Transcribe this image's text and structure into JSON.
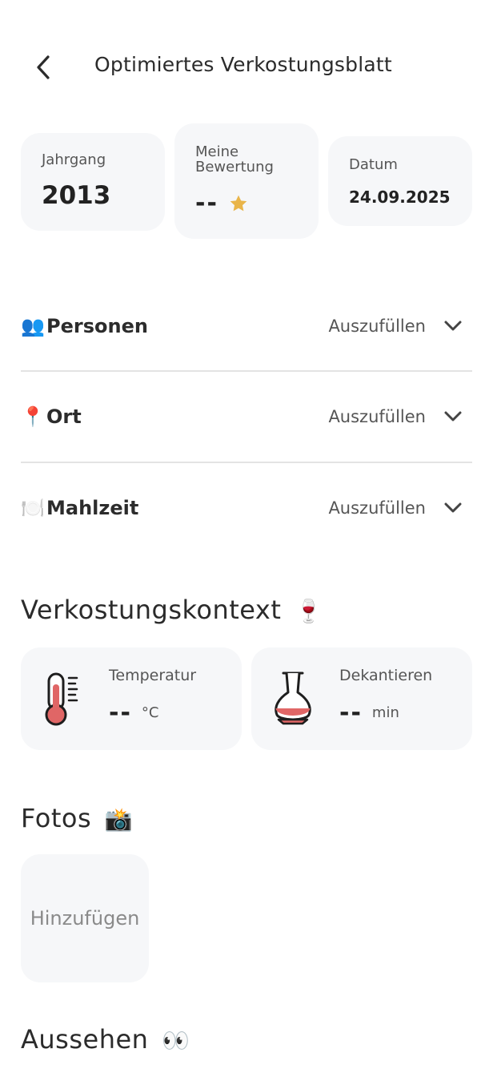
{
  "header": {
    "title": "Optimiertes Verkostungsblatt",
    "back_icon": "chevron-left-icon"
  },
  "cards": {
    "vintage": {
      "label": "Jahrgang",
      "value": "2013"
    },
    "rating": {
      "label_line1": "Meine",
      "label_line2": "Bewertung",
      "value": "--",
      "star_color": "#e9b54a"
    },
    "date": {
      "label": "Datum",
      "value": "24.09.2025"
    }
  },
  "accordion": [
    {
      "icon": "👥",
      "icon_name": "people-icon",
      "label": "Personen",
      "status": "Auszufüllen"
    },
    {
      "icon": "📍",
      "icon_name": "location-pin-icon",
      "label": "Ort",
      "status": "Auszufüllen"
    },
    {
      "icon": "🍽️",
      "icon_name": "plate-cutlery-icon",
      "label": "Mahlzeit",
      "status": "Auszufüllen"
    }
  ],
  "context": {
    "title": "Verkostungskontext",
    "title_emoji": "🍷",
    "temperature": {
      "label": "Temperatur",
      "value": "--",
      "unit": "°C"
    },
    "decanting": {
      "label": "Dekantieren",
      "value": "--",
      "unit": "min"
    }
  },
  "photos": {
    "title": "Fotos",
    "title_emoji": "📸",
    "add_label": "Hinzufügen"
  },
  "appearance": {
    "title": "Aussehen",
    "title_emoji": "👀"
  }
}
